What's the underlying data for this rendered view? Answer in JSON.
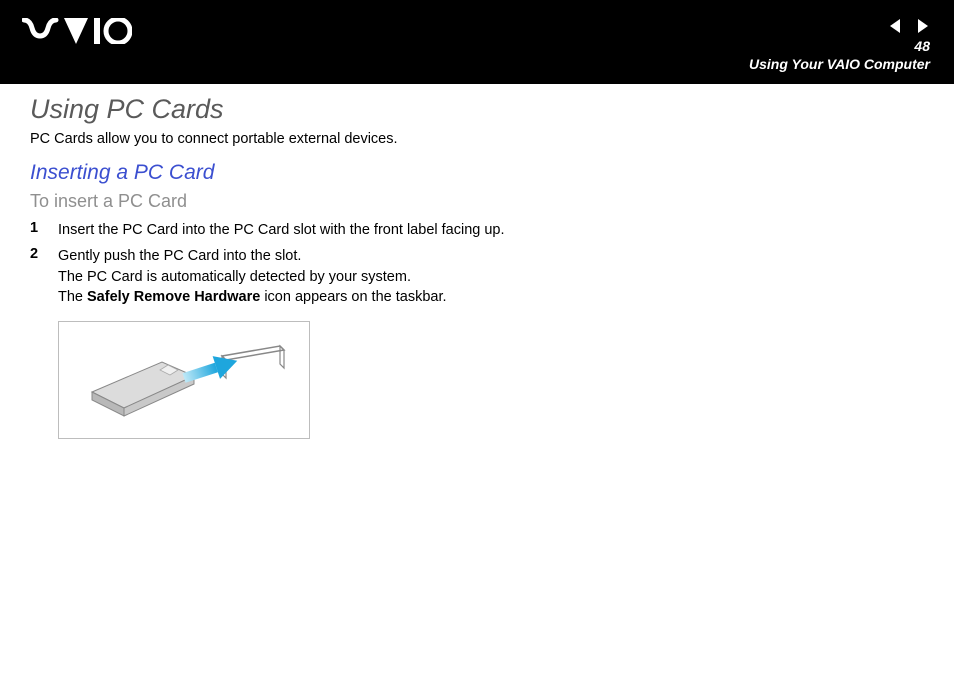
{
  "header": {
    "page_number": "48",
    "section_title": "Using Your VAIO Computer"
  },
  "content": {
    "title": "Using PC Cards",
    "intro": "PC Cards allow you to connect portable external devices.",
    "subtitle": "Inserting a PC Card",
    "procedure_title": "To insert a PC Card",
    "steps": [
      {
        "num": "1",
        "line1": "Insert the PC Card into the PC Card slot with the front label facing up."
      },
      {
        "num": "2",
        "line1": "Gently push the PC Card into the slot.",
        "line2": "The PC Card is automatically detected by your system.",
        "line3a": "The ",
        "line3_bold": "Safely Remove Hardware",
        "line3b": " icon appears on the taskbar."
      }
    ]
  }
}
